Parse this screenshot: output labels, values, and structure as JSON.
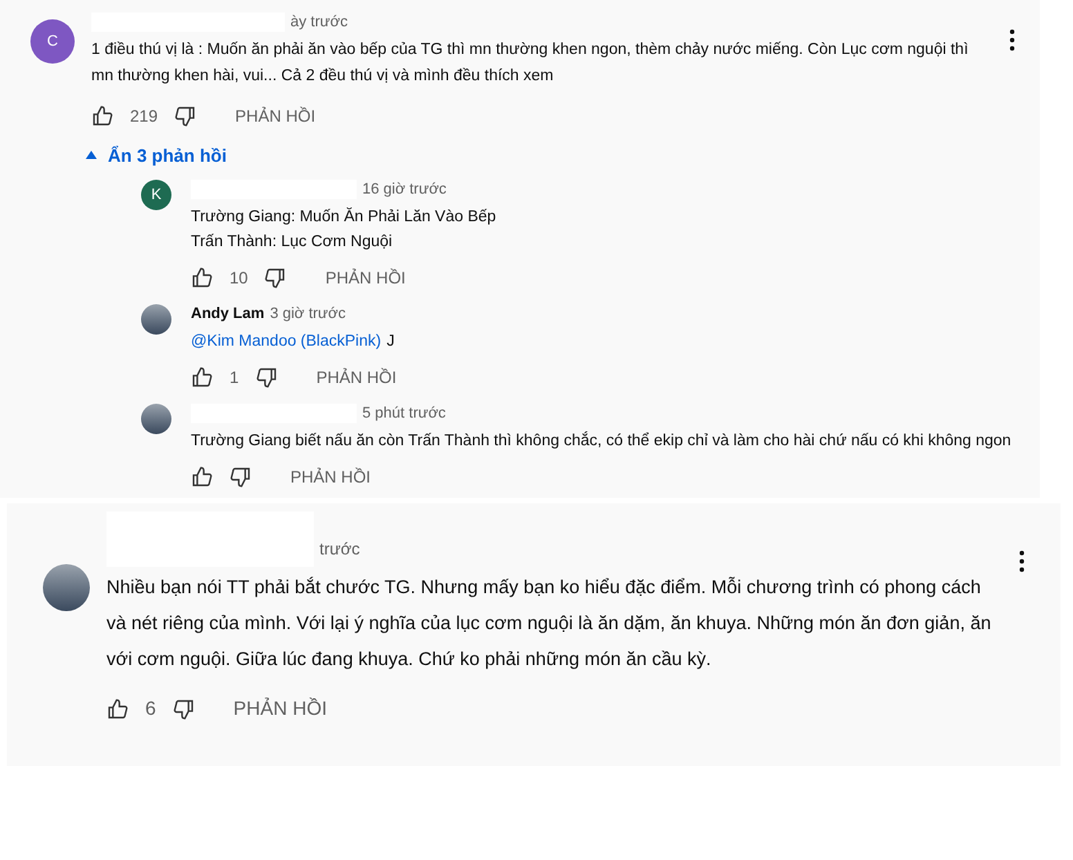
{
  "threads": [
    {
      "avatar": {
        "kind": "letter",
        "letter": "C",
        "color": "#7e57c2"
      },
      "time": "ày trước",
      "text": "1 điều thú vị là : Muốn ăn phải ăn vào bếp của TG thì mn thường khen ngon, thèm chảy nước miếng. Còn Lục cơm nguội thì mn thường khen hài, vui... Cả 2 đều thú vị và mình đều thích xem",
      "likes": "219",
      "reply_label": "PHẢN HỒI",
      "toggle": {
        "label": "Ẩn 3 phản hồi",
        "expanded": true
      },
      "replies": [
        {
          "avatar": {
            "kind": "letter",
            "letter": "K",
            "color": "#1e6b52"
          },
          "time": "16 giờ trước",
          "lines": [
            "Trường Giang: Muốn Ăn Phải Lăn Vào Bếp",
            "Trấn Thành: Lục Cơm Nguội"
          ],
          "likes": "10",
          "reply_label": "PHẢN HỒI"
        },
        {
          "avatar": {
            "kind": "photo"
          },
          "author": "Andy Lam",
          "time": "3 giờ trước",
          "mention": "@Kim Mandoo (BlackPink)",
          "lines": [
            "J"
          ],
          "likes": "1",
          "reply_label": "PHẢN HỒI"
        },
        {
          "avatar": {
            "kind": "photo"
          },
          "time": "5 phút trước",
          "lines": [
            "Trường Giang biết nấu ăn còn Trấn Thành thì không chắc, có thể ekip chỉ và làm cho hài chứ nấu có khi không ngon"
          ],
          "reply_label": "PHẢN HỒI"
        }
      ]
    },
    {
      "avatar": {
        "kind": "photo"
      },
      "time": "trước",
      "text": "Nhiều bạn nói TT phải bắt chước TG. Nhưng mấy bạn ko hiểu đặc điểm. Mỗi chương trình có phong cách và nét riêng của mình. Với lại ý nghĩa của lục cơm nguội là ăn dặm, ăn khuya. Những món ăn đơn giản, ăn với cơm nguội. Giữa lúc đang khuya. Chứ ko phải những món ăn cầu kỳ.",
      "likes": "6",
      "reply_label": "PHẢN HỒI"
    }
  ]
}
